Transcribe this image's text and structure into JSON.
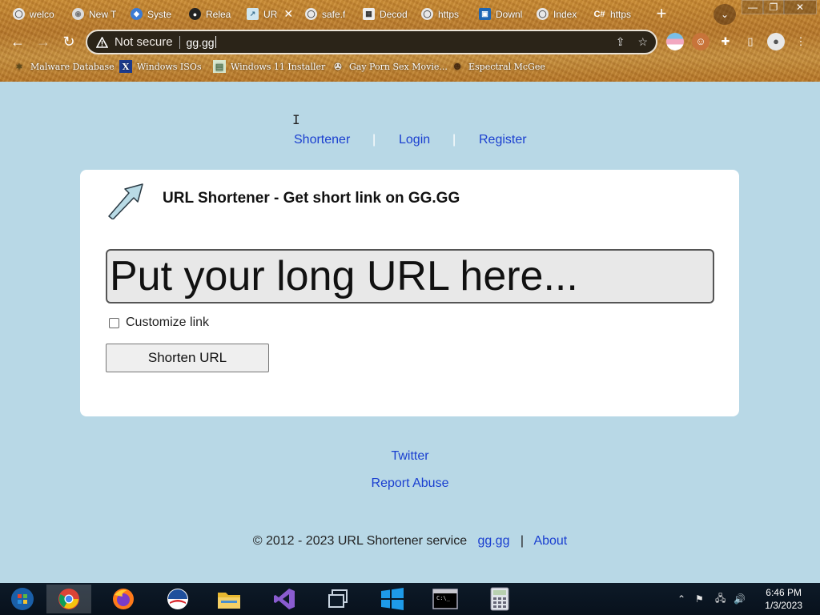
{
  "tabs": [
    {
      "title": "welco",
      "icon": "globe-icon"
    },
    {
      "title": "New T",
      "icon": "chrome-icon"
    },
    {
      "title": "Syste",
      "icon": "system-icon"
    },
    {
      "title": "Relea",
      "icon": "github-icon"
    },
    {
      "title": "UR",
      "icon": "arrow-icon",
      "active": true
    },
    {
      "title": "safe.f",
      "icon": "globe-icon"
    },
    {
      "title": "Decod",
      "icon": "decoder-icon"
    },
    {
      "title": "https",
      "icon": "globe-icon"
    },
    {
      "title": "Downl",
      "icon": "download-icon"
    },
    {
      "title": "Index",
      "icon": "globe-icon"
    },
    {
      "title": "https",
      "icon": "csharp-icon"
    }
  ],
  "omnibox": {
    "security_label": "Not secure",
    "url": "gg.gg"
  },
  "bookmarks": [
    {
      "label": "Malware Database",
      "icon": "malware-icon"
    },
    {
      "label": "Windows ISOs",
      "icon": "x-icon"
    },
    {
      "label": "Windows 11 Installer",
      "icon": "image-icon"
    },
    {
      "label": "Gay Porn Sex Movie...",
      "icon": "film-icon"
    },
    {
      "label": "Espectral McGee",
      "icon": "avatar-icon"
    }
  ],
  "nav": {
    "shortener": "Shortener",
    "login": "Login",
    "register": "Register",
    "separator": "|"
  },
  "card": {
    "title": "URL Shortener - Get short link on GG.GG",
    "input_placeholder": "Put your long URL here...",
    "customize_label": "Customize link",
    "shorten_button": "Shorten URL"
  },
  "footer": {
    "twitter": "Twitter",
    "report_abuse": "Report Abuse",
    "copyright": "© 2012 - 2023 URL Shortener service",
    "site_link": "gg.gg",
    "separator": "|",
    "about": "About"
  },
  "taskbar": {
    "time": "6:46 PM",
    "date": "1/3/2023",
    "apps": [
      "start-icon",
      "chrome-icon",
      "firefox-icon",
      "obama-icon",
      "file-explorer-icon",
      "visual-studio-icon",
      "task-view-icon",
      "windows-icon",
      "cmd-icon",
      "calculator-icon"
    ]
  },
  "colors": {
    "page_bg": "#b8d8e6",
    "link": "#1a3fd0",
    "card_bg": "#ffffff",
    "chrome_bg": "#c98a32"
  }
}
